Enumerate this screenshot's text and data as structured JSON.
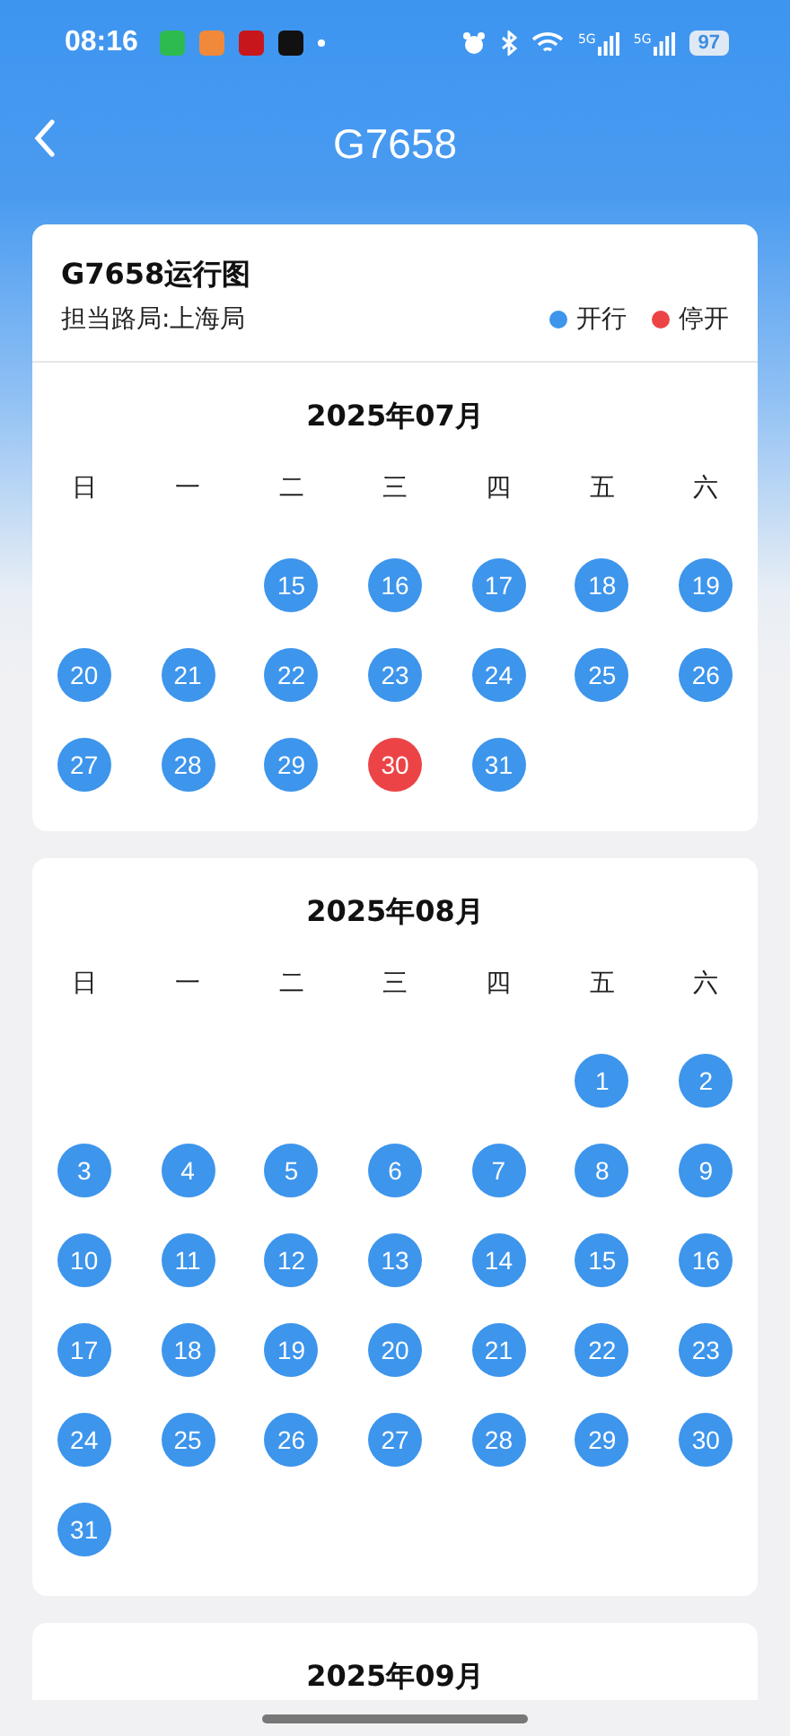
{
  "status_bar": {
    "time": "08:16",
    "battery": "97",
    "network": [
      "5G",
      "5G"
    ]
  },
  "header": {
    "title": "G7658"
  },
  "summary": {
    "title": "G7658运行图",
    "bureau": "担当路局:上海局",
    "legend": [
      {
        "label": "开行",
        "color": "#3d95ec"
      },
      {
        "label": "停开",
        "color": "#ec4446"
      }
    ]
  },
  "months": [
    {
      "title": "2025年07月",
      "weekdays": [
        "日",
        "一",
        "二",
        "三",
        "四",
        "五",
        "六"
      ],
      "weeks": [
        [
          {
            "kind": "blank"
          },
          {
            "kind": "blank"
          },
          {
            "kind": "day",
            "day": "15",
            "stopped": false
          },
          {
            "kind": "day",
            "day": "16",
            "stopped": false
          },
          {
            "kind": "day",
            "day": "17",
            "stopped": false
          },
          {
            "kind": "day",
            "day": "18",
            "stopped": false
          },
          {
            "kind": "day",
            "day": "19",
            "stopped": false
          }
        ],
        [
          {
            "kind": "day",
            "day": "20",
            "stopped": false
          },
          {
            "kind": "day",
            "day": "21",
            "stopped": false
          },
          {
            "kind": "day",
            "day": "22",
            "stopped": false
          },
          {
            "kind": "day",
            "day": "23",
            "stopped": false
          },
          {
            "kind": "day",
            "day": "24",
            "stopped": false
          },
          {
            "kind": "day",
            "day": "25",
            "stopped": false
          },
          {
            "kind": "day",
            "day": "26",
            "stopped": false
          }
        ],
        [
          {
            "kind": "day",
            "day": "27",
            "stopped": false
          },
          {
            "kind": "day",
            "day": "28",
            "stopped": false
          },
          {
            "kind": "day",
            "day": "29",
            "stopped": false
          },
          {
            "kind": "day",
            "day": "30",
            "stopped": true
          },
          {
            "kind": "day",
            "day": "31",
            "stopped": false
          }
        ]
      ]
    },
    {
      "title": "2025年08月",
      "weekdays": [
        "日",
        "一",
        "二",
        "三",
        "四",
        "五",
        "六"
      ],
      "weeks": [
        [
          {
            "kind": "blank"
          },
          {
            "kind": "blank"
          },
          {
            "kind": "blank"
          },
          {
            "kind": "blank"
          },
          {
            "kind": "blank"
          },
          {
            "kind": "day",
            "day": "1",
            "stopped": false
          },
          {
            "kind": "day",
            "day": "2",
            "stopped": false
          }
        ],
        [
          {
            "kind": "day",
            "day": "3",
            "stopped": false
          },
          {
            "kind": "day",
            "day": "4",
            "stopped": false
          },
          {
            "kind": "day",
            "day": "5",
            "stopped": false
          },
          {
            "kind": "day",
            "day": "6",
            "stopped": false
          },
          {
            "kind": "day",
            "day": "7",
            "stopped": false
          },
          {
            "kind": "day",
            "day": "8",
            "stopped": false
          },
          {
            "kind": "day",
            "day": "9",
            "stopped": false
          }
        ],
        [
          {
            "kind": "day",
            "day": "10",
            "stopped": false
          },
          {
            "kind": "day",
            "day": "11",
            "stopped": false
          },
          {
            "kind": "day",
            "day": "12",
            "stopped": false
          },
          {
            "kind": "day",
            "day": "13",
            "stopped": false
          },
          {
            "kind": "day",
            "day": "14",
            "stopped": false
          },
          {
            "kind": "day",
            "day": "15",
            "stopped": false
          },
          {
            "kind": "day",
            "day": "16",
            "stopped": false
          }
        ],
        [
          {
            "kind": "day",
            "day": "17",
            "stopped": false
          },
          {
            "kind": "day",
            "day": "18",
            "stopped": false
          },
          {
            "kind": "day",
            "day": "19",
            "stopped": false
          },
          {
            "kind": "day",
            "day": "20",
            "stopped": false
          },
          {
            "kind": "day",
            "day": "21",
            "stopped": false
          },
          {
            "kind": "day",
            "day": "22",
            "stopped": false
          },
          {
            "kind": "day",
            "day": "23",
            "stopped": false
          }
        ],
        [
          {
            "kind": "day",
            "day": "24",
            "stopped": false
          },
          {
            "kind": "day",
            "day": "25",
            "stopped": false
          },
          {
            "kind": "day",
            "day": "26",
            "stopped": false
          },
          {
            "kind": "day",
            "day": "27",
            "stopped": false
          },
          {
            "kind": "day",
            "day": "28",
            "stopped": false
          },
          {
            "kind": "day",
            "day": "29",
            "stopped": false
          },
          {
            "kind": "day",
            "day": "30",
            "stopped": false
          }
        ],
        [
          {
            "kind": "day",
            "day": "31",
            "stopped": false
          }
        ]
      ]
    },
    {
      "title": "2025年09月"
    }
  ]
}
